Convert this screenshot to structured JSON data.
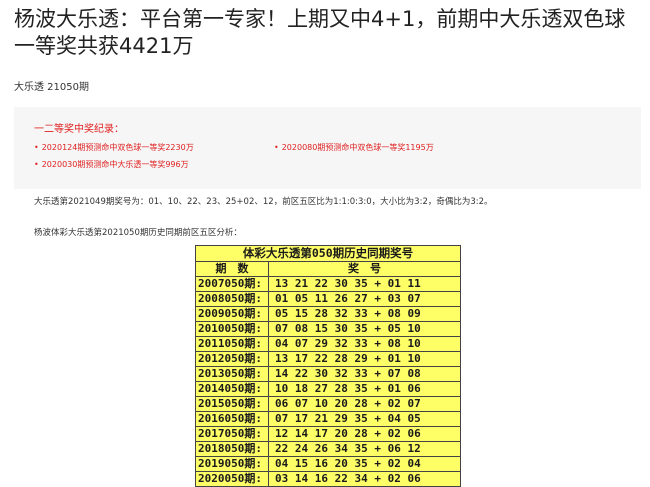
{
  "article": {
    "title": "杨波大乐透：平台第一专家！上期又中4+1，前期中大乐透双色球一等奖共获4421万",
    "issue": "大乐透 21050期"
  },
  "notice": {
    "heading": "一二等奖中奖纪录：",
    "items": [
      "2020124期预测命中双色球一等奖2230万",
      "2020080期预测命中双色球一等奖1195万",
      "2020030期预测命中大乐透一等奖996万"
    ]
  },
  "summary": {
    "last_draw": "大乐透第2021049期奖号为：01、10、22、23、25+02、12，前区五区比为1:1:0:3:0，大小比为3:2，奇偶比为3:2。",
    "analysis_intro": "杨波体彩大乐透第2021050期历史同期前区五区分析："
  },
  "history_table": {
    "caption": "体彩大乐透第050期历史同期奖号",
    "col_period": "期　数",
    "col_numbers": "奖　号",
    "rows": [
      {
        "period": "2007050期:",
        "numbers": "13 21 22 30 35 + 01 11"
      },
      {
        "period": "2008050期:",
        "numbers": "01 05 11 26 27 + 03 07"
      },
      {
        "period": "2009050期:",
        "numbers": "05 15 28 32 33 + 08 09"
      },
      {
        "period": "2010050期:",
        "numbers": "07 08 15 30 35 + 05 10"
      },
      {
        "period": "2011050期:",
        "numbers": "04 07 29 32 33 + 08 10"
      },
      {
        "period": "2012050期:",
        "numbers": "13 17 22 28 29 + 01 10"
      },
      {
        "period": "2013050期:",
        "numbers": "14 22 30 32 33 + 07 08"
      },
      {
        "period": "2014050期:",
        "numbers": "10 18 27 28 35 + 01 06"
      },
      {
        "period": "2015050期:",
        "numbers": "06 07 10 20 28 + 02 07"
      },
      {
        "period": "2016050期:",
        "numbers": "07 17 21 29 35 + 04 05"
      },
      {
        "period": "2017050期:",
        "numbers": "12 14 17 20 28 + 02 06"
      },
      {
        "period": "2018050期:",
        "numbers": "22 24 26 34 35 + 06 12"
      },
      {
        "period": "2019050期:",
        "numbers": "04 15 16 20 35 + 02 04"
      },
      {
        "period": "2020050期:",
        "numbers": "03 14 16 22 34 + 02 06"
      }
    ]
  },
  "colors": {
    "red": "#e02020",
    "table_bg": "#fefe66",
    "notice_bg": "#f6f6f6"
  }
}
